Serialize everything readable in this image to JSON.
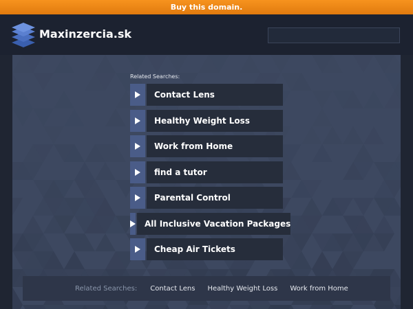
{
  "topbar": {
    "label": "Buy this domain."
  },
  "header": {
    "site_name": "Maxinzercia.sk",
    "search": {
      "value": ""
    },
    "logo": "stacked-layers-icon"
  },
  "related": {
    "title": "Related Searches:",
    "links": [
      "Contact Lens",
      "Healthy Weight Loss",
      "Work from Home",
      "find a tutor",
      "Parental Control",
      "All Inclusive Vacation Packages",
      "Cheap Air Tickets"
    ]
  },
  "footer": {
    "label": "Related Searches:",
    "links": [
      "Contact Lens",
      "Healthy Weight Loss",
      "Work from Home"
    ]
  },
  "colors": {
    "topbar": "#f7931e",
    "header": "#1c2230",
    "main": "#3d4860",
    "link_bg": "#262d3b",
    "arrow_bg": "#4a5c88"
  }
}
